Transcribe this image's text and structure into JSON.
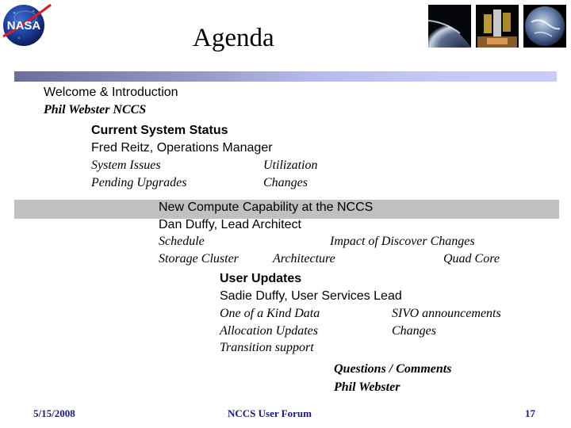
{
  "header": {
    "title": "Agenda",
    "logo": "nasa-meatball-logo",
    "thumbnails": [
      "earth-limb-photo",
      "hubble-telescope-photo",
      "earth-globe-photo"
    ]
  },
  "colors": {
    "header_bar_start": "#6d6d9c",
    "header_bar_end": "#cbcbfa",
    "highlight_band": "#c0c0c0",
    "footer_text": "#1a1a80"
  },
  "agenda": {
    "welcome": {
      "title": "Welcome & Introduction",
      "presenter": "Phil Webster  NCCS"
    },
    "system_status": {
      "title": "Current System Status",
      "presenter": "Fred Reitz, Operations Manager",
      "topics": [
        "System Issues",
        "Utilization",
        "Pending Upgrades",
        "Changes"
      ]
    },
    "compute": {
      "title": "New Compute Capability at the NCCS",
      "presenter": "Dan Duffy, Lead Architect",
      "topics": [
        "Schedule",
        "Impact of Discover Changes",
        "Storage Cluster",
        "Architecture",
        "Quad Core"
      ],
      "highlighted": true
    },
    "user_updates": {
      "title": "User Updates",
      "presenter": "Sadie Duffy, User Services Lead",
      "topics": [
        "One of a Kind Data",
        "SIVO announcements",
        "Allocation Updates",
        "Changes",
        "Transition support"
      ]
    },
    "questions": {
      "title": "Questions / Comments",
      "presenter": "Phil Webster"
    }
  },
  "footer": {
    "date": "5/15/2008",
    "event": "NCCS User Forum",
    "page_number": "17"
  }
}
